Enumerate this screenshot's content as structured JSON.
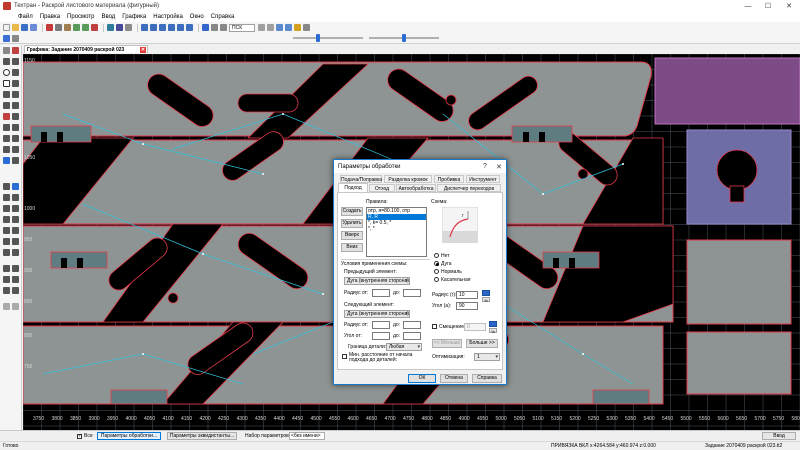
{
  "window": {
    "title": "Техтран - Раскрой листового материала (фигурный)",
    "minimize": "—",
    "maximize": "☐",
    "close": "✕"
  },
  "menu": [
    "Файл",
    "Правка",
    "Просмотр",
    "Ввод",
    "Графика",
    "Настройка",
    "Окно",
    "Справка"
  ],
  "toolbar": {
    "coord_system": "ПСК",
    "slider1_level": 0.35,
    "slider2_level": 0.5
  },
  "document_tab": {
    "label": "Графика: Задание 2070409 раскрой 023"
  },
  "canvas": {
    "y_labels": [
      "1150",
      "1050",
      "1000",
      "950",
      "900",
      "850",
      "800",
      "750"
    ],
    "x_labels": [
      "3750",
      "3800",
      "3850",
      "3900",
      "3950",
      "4000",
      "4050",
      "4100",
      "4150",
      "4200",
      "4250",
      "4300",
      "4350",
      "4400",
      "4450",
      "4500",
      "4550",
      "4600",
      "4650",
      "4700",
      "4750",
      "4800",
      "4850",
      "4900",
      "4950",
      "5000",
      "5050",
      "5100",
      "5150",
      "5200",
      "5250",
      "5300",
      "5350",
      "5400",
      "5450",
      "5500",
      "5550",
      "5600",
      "5650",
      "5700",
      "5750",
      "5800"
    ],
    "colors": {
      "background": "#000000",
      "part_fill": "#8e9493",
      "part_outline": "#e23a4a",
      "grid": "#4c5763",
      "purple_part": "#7d4c86",
      "lavender_part": "#6e6da6"
    }
  },
  "dialog": {
    "title": "Параметры обработки",
    "help": "?",
    "close": "✕",
    "tabs_row1": [
      "Подача/Поправка",
      "Разделка кромок",
      "Пробивка",
      "Инструмент"
    ],
    "tabs_row2": [
      "Подход",
      "Отход",
      "Автообработка",
      "Диспетчер переходов"
    ],
    "rules_label": "Правила:",
    "rules": [
      "отр, я=80.100, отр",
      "R, R",
      "*, k= 0.5, *",
      "*, *"
    ],
    "buttons_side": [
      "Создать",
      "Удалить",
      "Вверх",
      "Вниз"
    ],
    "scheme_label": "Схема:",
    "conditions_label": "Условия применения схемы:",
    "prev_element_label": "Предыдущий элемент:",
    "prev_element_value": "Дуга (внутренняя сторона)",
    "radius_from": "Радиус от:",
    "to": "до:",
    "next_element_label": "Следующий элемент:",
    "next_element_value": "Дуга (внутренняя сторона)",
    "angle_from": "Угол от:",
    "part_border_label": "Граница детали:",
    "part_border_value": "Любая",
    "min_distance_label": "Мин. расстояние от начала подхода до деталей:",
    "radio_options": [
      "Нет",
      "Дуга",
      "Нормаль",
      "Касательная"
    ],
    "radio_selected": "Дуга",
    "radius_label": "Радиус (r):",
    "radius_value": "10",
    "angle_label": "Угол (a):",
    "angle_value": "90",
    "offset_label": "Смещение:",
    "offset_value": "0",
    "pct": "%",
    "less_button": "<< Меньше",
    "more_button": "Больше >>",
    "optimization_label": "Оптимизация:",
    "optimization_value": "1",
    "ok": "ОК",
    "cancel": "Отмена",
    "help_button": "Справка"
  },
  "statusrow": {
    "all_label": "Все",
    "processing_params": "Параметры обработки...",
    "equidistant_params": "Параметры эквидистанты...",
    "param_set_label": "Набор параметров:",
    "param_set_value": "<без имени>",
    "input_button": "Ввод"
  },
  "statusbar": {
    "ready": "Готово",
    "snap": "ПРИВЯЗКА ВКЛ",
    "coords": "x:4264.584 y:460.974 z:0.000",
    "job": "Задание 2070409 раскрой 023.tt2"
  }
}
